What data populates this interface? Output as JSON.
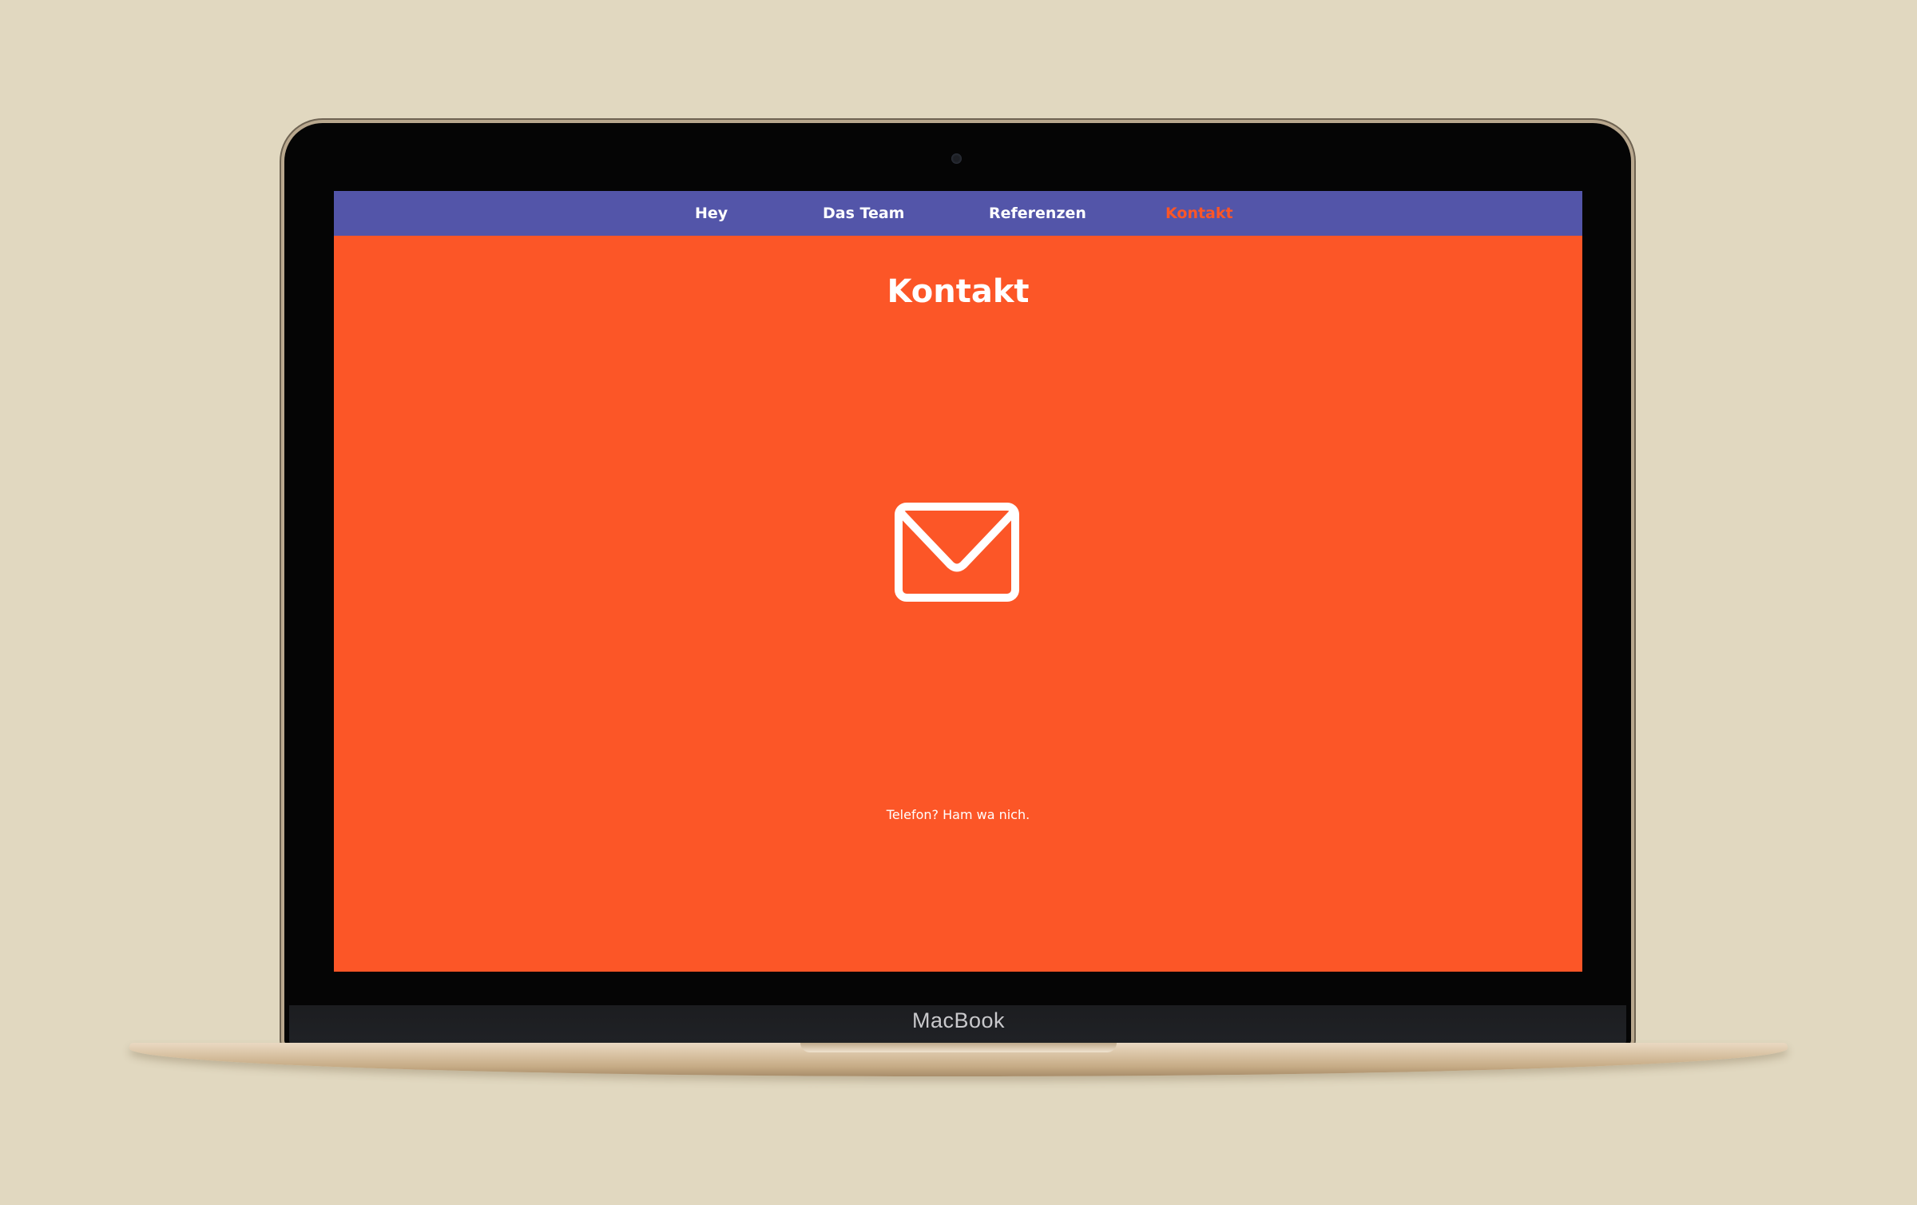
{
  "device": {
    "brand_label": "MacBook"
  },
  "colors": {
    "background": "#e1d8c0",
    "nav_background": "#5355a9",
    "page_background": "#fc5627",
    "active_nav": "#fc5627",
    "text": "#ffffff"
  },
  "nav": {
    "items": [
      {
        "label": "Hey",
        "active": false
      },
      {
        "label": "Das Team",
        "active": false
      },
      {
        "label": "Referenzen",
        "active": false
      },
      {
        "label": "Kontakt",
        "active": true
      }
    ]
  },
  "page": {
    "title": "Kontakt",
    "mail_icon": "envelope-icon",
    "phone_note": "Telefon? Ham wa nich."
  }
}
